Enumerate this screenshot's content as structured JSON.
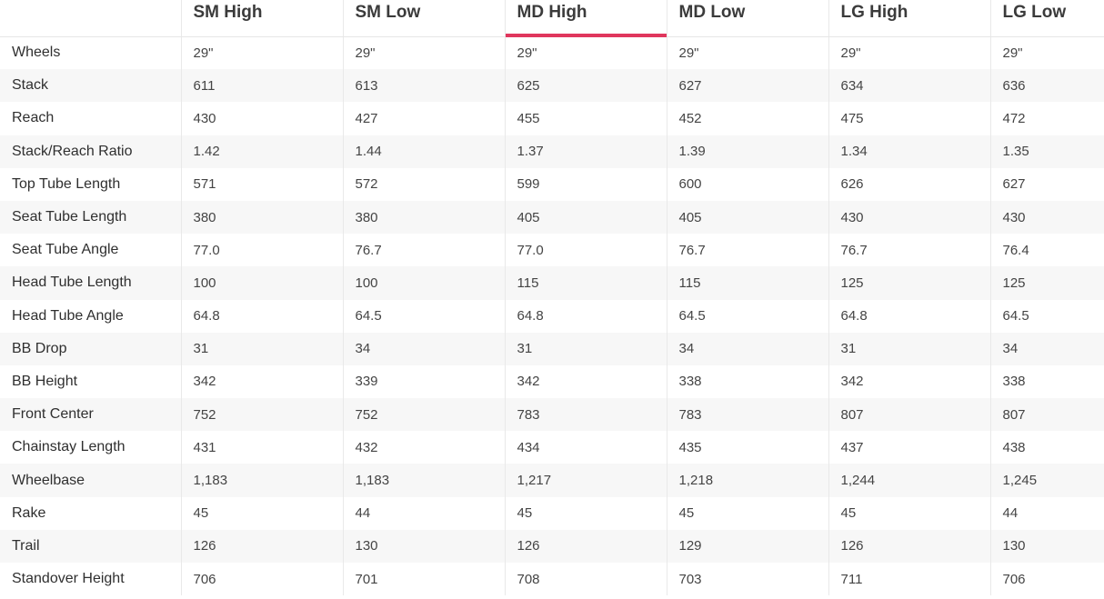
{
  "table": {
    "columns": [
      "",
      "SM High",
      "SM Low",
      "MD High",
      "MD Low",
      "LG High",
      "LG Low"
    ],
    "active_column": "MD High",
    "accent_color": "#e0365d",
    "rows": [
      {
        "label": "Wheels",
        "values": [
          "29\"",
          "29\"",
          "29\"",
          "29\"",
          "29\"",
          "29\""
        ]
      },
      {
        "label": "Stack",
        "values": [
          "611",
          "613",
          "625",
          "627",
          "634",
          "636"
        ]
      },
      {
        "label": "Reach",
        "values": [
          "430",
          "427",
          "455",
          "452",
          "475",
          "472"
        ]
      },
      {
        "label": "Stack/Reach Ratio",
        "values": [
          "1.42",
          "1.44",
          "1.37",
          "1.39",
          "1.34",
          "1.35"
        ]
      },
      {
        "label": "Top Tube Length",
        "values": [
          "571",
          "572",
          "599",
          "600",
          "626",
          "627"
        ]
      },
      {
        "label": "Seat Tube Length",
        "values": [
          "380",
          "380",
          "405",
          "405",
          "430",
          "430"
        ]
      },
      {
        "label": "Seat Tube Angle",
        "values": [
          "77.0",
          "76.7",
          "77.0",
          "76.7",
          "76.7",
          "76.4"
        ]
      },
      {
        "label": "Head Tube Length",
        "values": [
          "100",
          "100",
          "115",
          "115",
          "125",
          "125"
        ]
      },
      {
        "label": "Head Tube Angle",
        "values": [
          "64.8",
          "64.5",
          "64.8",
          "64.5",
          "64.8",
          "64.5"
        ]
      },
      {
        "label": "BB Drop",
        "values": [
          "31",
          "34",
          "31",
          "34",
          "31",
          "34"
        ]
      },
      {
        "label": "BB Height",
        "values": [
          "342",
          "339",
          "342",
          "338",
          "342",
          "338"
        ]
      },
      {
        "label": "Front Center",
        "values": [
          "752",
          "752",
          "783",
          "783",
          "807",
          "807"
        ]
      },
      {
        "label": "Chainstay Length",
        "values": [
          "431",
          "432",
          "434",
          "435",
          "437",
          "438"
        ]
      },
      {
        "label": "Wheelbase",
        "values": [
          "1,183",
          "1,183",
          "1,217",
          "1,218",
          "1,244",
          "1,245"
        ]
      },
      {
        "label": "Rake",
        "values": [
          "45",
          "44",
          "45",
          "45",
          "45",
          "44"
        ]
      },
      {
        "label": "Trail",
        "values": [
          "126",
          "130",
          "126",
          "129",
          "126",
          "130"
        ]
      },
      {
        "label": "Standover Height",
        "values": [
          "706",
          "701",
          "708",
          "703",
          "711",
          "706"
        ]
      }
    ]
  }
}
